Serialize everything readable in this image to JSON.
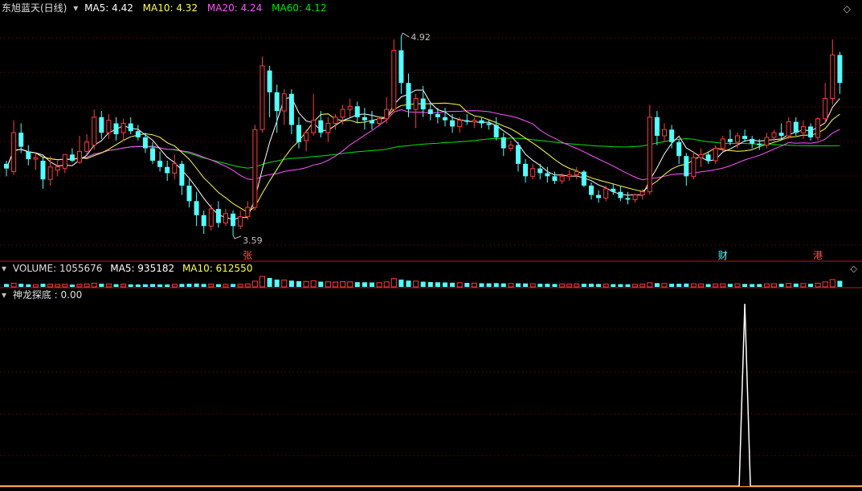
{
  "title_bar": {
    "stock_name": "东旭蓝天(日线)",
    "ma5_label": "MA5: 4.42",
    "ma10_label": "MA10: 4.32",
    "ma20_label": "MA20: 4.24",
    "ma60_label": "MA60: 4.12"
  },
  "volume_bar": {
    "volume_label": "VOLUME: 1055676",
    "ma5_label": "MA5: 935182",
    "ma10_label": "MA10: 612550"
  },
  "indicator_bar": {
    "label": "神龙探底 : 0.00"
  },
  "markers": [
    {
      "text": "张"
    },
    {
      "text": "财"
    },
    {
      "text": "港"
    }
  ],
  "colors": {
    "up": "#ff3c3c",
    "down": "#54ffff",
    "ma5": "#ffffff",
    "ma10": "#ffff54",
    "ma20": "#ff54ff",
    "ma60": "#00e600",
    "grid": "#8b0000",
    "indicator": "#ffffff"
  },
  "chart_data": {
    "type": "candlestick",
    "price_high_label": "4.92",
    "price_low_label": "3.59",
    "price_range": [
      3.5,
      5.05
    ],
    "candles": [
      [
        4.1,
        4.12,
        4.02,
        4.07
      ],
      [
        4.05,
        4.38,
        4.03,
        4.3
      ],
      [
        4.3,
        4.36,
        4.17,
        4.21
      ],
      [
        4.18,
        4.22,
        4.09,
        4.13
      ],
      [
        4.13,
        4.17,
        4.06,
        4.14
      ],
      [
        4.12,
        4.14,
        3.94,
        4.0
      ],
      [
        4.0,
        4.15,
        3.96,
        4.08
      ],
      [
        4.06,
        4.12,
        4.02,
        4.08
      ],
      [
        4.07,
        4.16,
        4.04,
        4.16
      ],
      [
        4.16,
        4.2,
        4.11,
        4.12
      ],
      [
        4.11,
        4.28,
        4.1,
        4.18
      ],
      [
        4.18,
        4.29,
        4.16,
        4.24
      ],
      [
        4.22,
        4.45,
        4.19,
        4.4
      ],
      [
        4.4,
        4.44,
        4.26,
        4.3
      ],
      [
        4.3,
        4.42,
        4.26,
        4.38
      ],
      [
        4.36,
        4.4,
        4.25,
        4.29
      ],
      [
        4.3,
        4.39,
        4.25,
        4.36
      ],
      [
        4.36,
        4.4,
        4.29,
        4.31
      ],
      [
        4.31,
        4.35,
        4.25,
        4.27
      ],
      [
        4.27,
        4.3,
        4.17,
        4.2
      ],
      [
        4.2,
        4.24,
        4.1,
        4.12
      ],
      [
        4.12,
        4.18,
        4.05,
        4.08
      ],
      [
        4.08,
        4.12,
        3.99,
        4.04
      ],
      [
        4.04,
        4.16,
        4.0,
        4.1
      ],
      [
        4.1,
        4.12,
        3.9,
        3.96
      ],
      [
        3.96,
        4.0,
        3.82,
        3.86
      ],
      [
        3.86,
        3.92,
        3.7,
        3.77
      ],
      [
        3.77,
        3.8,
        3.65,
        3.7
      ],
      [
        3.7,
        3.84,
        3.67,
        3.81
      ],
      [
        3.81,
        3.86,
        3.69,
        3.72
      ],
      [
        3.72,
        3.81,
        3.7,
        3.78
      ],
      [
        3.78,
        3.8,
        3.64,
        3.7
      ],
      [
        3.7,
        3.8,
        3.68,
        3.76
      ],
      [
        3.76,
        3.86,
        3.74,
        3.82
      ],
      [
        3.82,
        4.35,
        3.8,
        4.32
      ],
      [
        4.32,
        4.79,
        4.3,
        4.73
      ],
      [
        4.7,
        4.73,
        4.4,
        4.56
      ],
      [
        4.56,
        4.61,
        4.3,
        4.44
      ],
      [
        4.44,
        4.58,
        4.35,
        4.55
      ],
      [
        4.55,
        4.58,
        4.29,
        4.35
      ],
      [
        4.35,
        4.4,
        4.2,
        4.24
      ],
      [
        4.25,
        4.32,
        4.18,
        4.3
      ],
      [
        4.3,
        4.55,
        4.28,
        4.38
      ],
      [
        4.38,
        4.44,
        4.27,
        4.3
      ],
      [
        4.3,
        4.4,
        4.24,
        4.36
      ],
      [
        4.36,
        4.42,
        4.32,
        4.4
      ],
      [
        4.4,
        4.48,
        4.35,
        4.45
      ],
      [
        4.45,
        4.52,
        4.4,
        4.47
      ],
      [
        4.47,
        4.5,
        4.36,
        4.4
      ],
      [
        4.4,
        4.46,
        4.32,
        4.38
      ],
      [
        4.38,
        4.44,
        4.32,
        4.36
      ],
      [
        4.36,
        4.4,
        4.34,
        4.39
      ],
      [
        4.39,
        4.53,
        4.36,
        4.45
      ],
      [
        4.45,
        4.9,
        4.43,
        4.83
      ],
      [
        4.83,
        4.92,
        4.55,
        4.62
      ],
      [
        4.62,
        4.68,
        4.4,
        4.45
      ],
      [
        4.45,
        4.55,
        4.33,
        4.52
      ],
      [
        4.52,
        4.6,
        4.4,
        4.45
      ],
      [
        4.45,
        4.5,
        4.38,
        4.42
      ],
      [
        4.42,
        4.46,
        4.36,
        4.4
      ],
      [
        4.4,
        4.46,
        4.34,
        4.38
      ],
      [
        4.38,
        4.42,
        4.3,
        4.34
      ],
      [
        4.34,
        4.4,
        4.3,
        4.38
      ],
      [
        4.38,
        4.42,
        4.35,
        4.37
      ],
      [
        4.37,
        4.4,
        4.33,
        4.38
      ],
      [
        4.38,
        4.4,
        4.33,
        4.36
      ],
      [
        4.36,
        4.38,
        4.32,
        4.35
      ],
      [
        4.35,
        4.4,
        4.25,
        4.27
      ],
      [
        4.27,
        4.3,
        4.15,
        4.2
      ],
      [
        4.2,
        4.25,
        4.18,
        4.22
      ],
      [
        4.22,
        4.24,
        4.05,
        4.1
      ],
      [
        4.1,
        4.13,
        3.98,
        4.02
      ],
      [
        4.02,
        4.1,
        4.0,
        4.07
      ],
      [
        4.07,
        4.1,
        4.0,
        4.04
      ],
      [
        4.04,
        4.08,
        3.98,
        4.02
      ],
      [
        4.02,
        4.05,
        3.97,
        3.99
      ],
      [
        3.99,
        4.04,
        3.97,
        4.02
      ],
      [
        4.02,
        4.06,
        3.99,
        4.03
      ],
      [
        4.03,
        4.08,
        4.0,
        4.05
      ],
      [
        4.05,
        4.06,
        3.95,
        3.96
      ],
      [
        3.96,
        3.98,
        3.87,
        3.9
      ],
      [
        3.9,
        3.93,
        3.85,
        3.88
      ],
      [
        3.88,
        3.96,
        3.86,
        3.94
      ],
      [
        3.94,
        3.97,
        3.9,
        3.92
      ],
      [
        3.92,
        3.96,
        3.86,
        3.88
      ],
      [
        3.88,
        3.92,
        3.84,
        3.87
      ],
      [
        3.87,
        3.91,
        3.85,
        3.9
      ],
      [
        3.9,
        3.94,
        3.87,
        3.92
      ],
      [
        3.92,
        4.48,
        3.9,
        4.4
      ],
      [
        4.4,
        4.44,
        4.22,
        4.28
      ],
      [
        4.28,
        4.36,
        4.24,
        4.32
      ],
      [
        4.32,
        4.35,
        4.2,
        4.24
      ],
      [
        4.24,
        4.26,
        4.1,
        4.15
      ],
      [
        4.15,
        4.17,
        3.96,
        4.02
      ],
      [
        4.02,
        4.18,
        4.0,
        4.14
      ],
      [
        4.14,
        4.2,
        4.08,
        4.16
      ],
      [
        4.16,
        4.18,
        4.1,
        4.12
      ],
      [
        4.12,
        4.22,
        4.1,
        4.2
      ],
      [
        4.2,
        4.28,
        4.18,
        4.26
      ],
      [
        4.26,
        4.32,
        4.22,
        4.24
      ],
      [
        4.24,
        4.3,
        4.2,
        4.28
      ],
      [
        4.28,
        4.32,
        4.24,
        4.26
      ],
      [
        4.26,
        4.28,
        4.2,
        4.23
      ],
      [
        4.23,
        4.26,
        4.19,
        4.22
      ],
      [
        4.22,
        4.3,
        4.2,
        4.27
      ],
      [
        4.27,
        4.32,
        4.24,
        4.3
      ],
      [
        4.3,
        4.36,
        4.26,
        4.28
      ],
      [
        4.28,
        4.4,
        4.26,
        4.37
      ],
      [
        4.37,
        4.4,
        4.28,
        4.3
      ],
      [
        4.3,
        4.38,
        4.26,
        4.34
      ],
      [
        4.34,
        4.36,
        4.25,
        4.27
      ],
      [
        4.27,
        4.4,
        4.25,
        4.39
      ],
      [
        4.39,
        4.62,
        4.36,
        4.52
      ],
      [
        4.52,
        4.9,
        4.48,
        4.8
      ],
      [
        4.8,
        4.82,
        4.55,
        4.62
      ]
    ],
    "volumes": [
      0.28,
      0.35,
      0.3,
      0.25,
      0.22,
      0.3,
      0.26,
      0.24,
      0.25,
      0.22,
      0.26,
      0.28,
      0.36,
      0.3,
      0.28,
      0.26,
      0.27,
      0.24,
      0.23,
      0.25,
      0.27,
      0.24,
      0.23,
      0.25,
      0.28,
      0.3,
      0.32,
      0.28,
      0.27,
      0.26,
      0.25,
      0.28,
      0.26,
      0.28,
      0.55,
      1.0,
      0.85,
      0.7,
      0.66,
      0.6,
      0.55,
      0.52,
      0.58,
      0.5,
      0.48,
      0.46,
      0.5,
      0.48,
      0.45,
      0.44,
      0.42,
      0.4,
      0.48,
      0.8,
      0.7,
      0.6,
      0.55,
      0.5,
      0.46,
      0.44,
      0.42,
      0.4,
      0.4,
      0.38,
      0.36,
      0.35,
      0.34,
      0.36,
      0.34,
      0.32,
      0.34,
      0.33,
      0.3,
      0.3,
      0.3,
      0.28,
      0.28,
      0.27,
      0.28,
      0.3,
      0.3,
      0.28,
      0.27,
      0.26,
      0.26,
      0.25,
      0.25,
      0.27,
      0.4,
      0.36,
      0.32,
      0.3,
      0.3,
      0.32,
      0.3,
      0.28,
      0.27,
      0.28,
      0.3,
      0.29,
      0.3,
      0.28,
      0.27,
      0.27,
      0.29,
      0.3,
      0.3,
      0.34,
      0.32,
      0.32,
      0.3,
      0.36,
      0.48,
      0.7,
      0.58
    ],
    "volume_max": 1.0,
    "indicator_signal_index": 101,
    "indicator_signal_value": 1.0,
    "marker_indices": [
      33,
      98,
      111
    ]
  }
}
